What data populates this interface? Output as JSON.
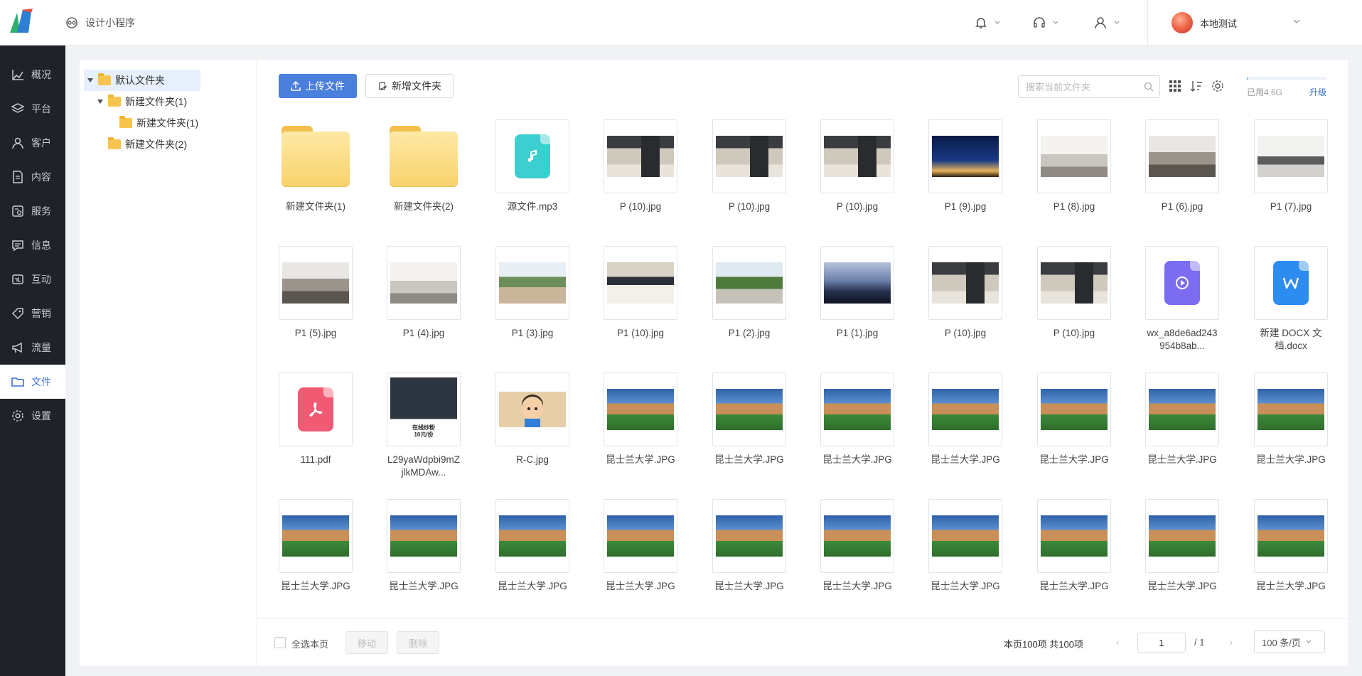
{
  "header": {
    "app_title": "设计小程序",
    "user_name": "本地测试"
  },
  "nav": [
    {
      "label": "概况",
      "icon": "chart-line-icon"
    },
    {
      "label": "平台",
      "icon": "layers-icon"
    },
    {
      "label": "客户",
      "icon": "user-icon"
    },
    {
      "label": "内容",
      "icon": "document-icon"
    },
    {
      "label": "服务",
      "icon": "service-icon"
    },
    {
      "label": "信息",
      "icon": "message-icon"
    },
    {
      "label": "互动",
      "icon": "interaction-icon"
    },
    {
      "label": "营销",
      "icon": "tag-icon"
    },
    {
      "label": "流量",
      "icon": "megaphone-icon"
    },
    {
      "label": "文件",
      "icon": "folder-icon",
      "active": true
    },
    {
      "label": "设置",
      "icon": "gear-icon"
    }
  ],
  "tree": [
    {
      "label": "默认文件夹",
      "level": 0,
      "expanded": true,
      "selected": true
    },
    {
      "label": "新建文件夹(1)",
      "level": 1,
      "expanded": true
    },
    {
      "label": "新建文件夹(1)",
      "level": 2
    },
    {
      "label": "新建文件夹(2)",
      "level": 1
    }
  ],
  "toolbar": {
    "upload_label": "上传文件",
    "new_folder_label": "新增文件夹",
    "search_placeholder": "搜索当前文件夹",
    "storage_used": "已用4.6G",
    "storage_fraction": 0.01,
    "upgrade_label": "升级"
  },
  "files": [
    {
      "name": "新建文件夹(1)",
      "kind": "folder"
    },
    {
      "name": "新建文件夹(2)",
      "kind": "folder"
    },
    {
      "name": "源文件.mp3",
      "kind": "audio"
    },
    {
      "name": "P (10).jpg",
      "kind": "image",
      "swatch": "kitchen"
    },
    {
      "name": "P (10).jpg",
      "kind": "image",
      "swatch": "kitchen"
    },
    {
      "name": "P (10).jpg",
      "kind": "image",
      "swatch": "kitchen"
    },
    {
      "name": "P1 (9).jpg",
      "kind": "image",
      "swatch": "city"
    },
    {
      "name": "P1 (8).jpg",
      "kind": "image",
      "swatch": "interior"
    },
    {
      "name": "P1 (6).jpg",
      "kind": "image",
      "swatch": "living"
    },
    {
      "name": "P1 (7).jpg",
      "kind": "image",
      "swatch": "gym"
    },
    {
      "name": "P1 (5).jpg",
      "kind": "image",
      "swatch": "living"
    },
    {
      "name": "P1 (4).jpg",
      "kind": "image",
      "swatch": "interior"
    },
    {
      "name": "P1 (3).jpg",
      "kind": "image",
      "swatch": "street"
    },
    {
      "name": "P1 (10).jpg",
      "kind": "image",
      "swatch": "bedroom"
    },
    {
      "name": "P1 (2).jpg",
      "kind": "image",
      "swatch": "palms"
    },
    {
      "name": "P1 (1).jpg",
      "kind": "image",
      "swatch": "dusk"
    },
    {
      "name": "P (10).jpg",
      "kind": "image",
      "swatch": "kitchen"
    },
    {
      "name": "P (10).jpg",
      "kind": "image",
      "swatch": "kitchen"
    },
    {
      "name": "wx_a8de6ad243954b8ab...",
      "kind": "video"
    },
    {
      "name": "新建 DOCX 文档.docx",
      "kind": "docx"
    },
    {
      "name": "111.pdf",
      "kind": "pdf"
    },
    {
      "name": "L29yaWdpbi9mZjlkMDAw...",
      "kind": "food",
      "thumb_caption": "在线炒粉\n10元/份"
    },
    {
      "name": "R-C.jpg",
      "kind": "cartoon"
    },
    {
      "name": "昆士兰大学.JPG",
      "kind": "image",
      "swatch": "uq"
    },
    {
      "name": "昆士兰大学.JPG",
      "kind": "image",
      "swatch": "uq"
    },
    {
      "name": "昆士兰大学.JPG",
      "kind": "image",
      "swatch": "uq"
    },
    {
      "name": "昆士兰大学.JPG",
      "kind": "image",
      "swatch": "uq"
    },
    {
      "name": "昆士兰大学.JPG",
      "kind": "image",
      "swatch": "uq"
    },
    {
      "name": "昆士兰大学.JPG",
      "kind": "image",
      "swatch": "uq"
    },
    {
      "name": "昆士兰大学.JPG",
      "kind": "image",
      "swatch": "uq"
    },
    {
      "name": "昆士兰大学.JPG",
      "kind": "image",
      "swatch": "uq"
    },
    {
      "name": "昆士兰大学.JPG",
      "kind": "image",
      "swatch": "uq"
    },
    {
      "name": "昆士兰大学.JPG",
      "kind": "image",
      "swatch": "uq"
    },
    {
      "name": "昆士兰大学.JPG",
      "kind": "image",
      "swatch": "uq"
    },
    {
      "name": "昆士兰大学.JPG",
      "kind": "image",
      "swatch": "uq"
    },
    {
      "name": "昆士兰大学.JPG",
      "kind": "image",
      "swatch": "uq"
    },
    {
      "name": "昆士兰大学.JPG",
      "kind": "image",
      "swatch": "uq"
    },
    {
      "name": "昆士兰大学.JPG",
      "kind": "image",
      "swatch": "uq"
    },
    {
      "name": "昆士兰大学.JPG",
      "kind": "image",
      "swatch": "uq"
    },
    {
      "name": "昆士兰大学.JPG",
      "kind": "image",
      "swatch": "uq"
    }
  ],
  "footer": {
    "select_all_label": "全选本页",
    "move_label": "移动",
    "delete_label": "删除",
    "page_info": "本页100项  共100项",
    "current_page": "1",
    "total_pages": "/  1",
    "page_size": "100 条/页"
  },
  "colors": {
    "accent": "#4a7fdc",
    "nav_bg": "#1f2227",
    "audio_badge": "#3ccfcf",
    "video_badge": "#7b6cf0",
    "docx_badge": "#2d8cf0",
    "pdf_badge": "#f05a72"
  }
}
